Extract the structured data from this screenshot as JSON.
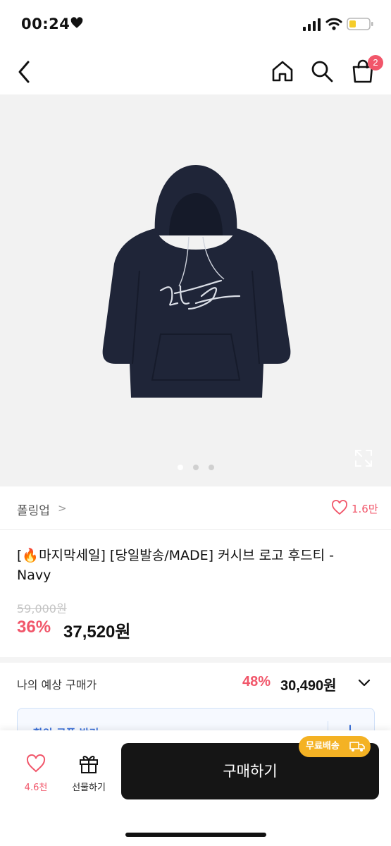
{
  "status_bar": {
    "time": "00:24"
  },
  "nav": {
    "cart_count": "2"
  },
  "hero": {
    "slide_count": 3,
    "active_slide": 0
  },
  "seller": {
    "name": "폴링업",
    "chevron": ">",
    "likes": "1.6만"
  },
  "product": {
    "title": "[🔥마지막세일] [당일발송/MADE] 커시브 로고 후드티  - Navy",
    "original_price": "59,000원",
    "discount": "36%",
    "price": "37,520원"
  },
  "expected_price": {
    "label": "나의 예상 구매가",
    "discount": "48%",
    "price": "30,490원"
  },
  "coupon": {
    "label": "할인 쿠폰 받기"
  },
  "bottom_bar": {
    "wish_count": "4.6천",
    "gift_label": "선물하기",
    "buy_label": "구매하기",
    "free_shipping": "무료배송"
  },
  "colors": {
    "accent": "#f1566a",
    "buy_button": "#151515",
    "free_badge": "#f4b224",
    "hoodie": "#1f2538"
  }
}
